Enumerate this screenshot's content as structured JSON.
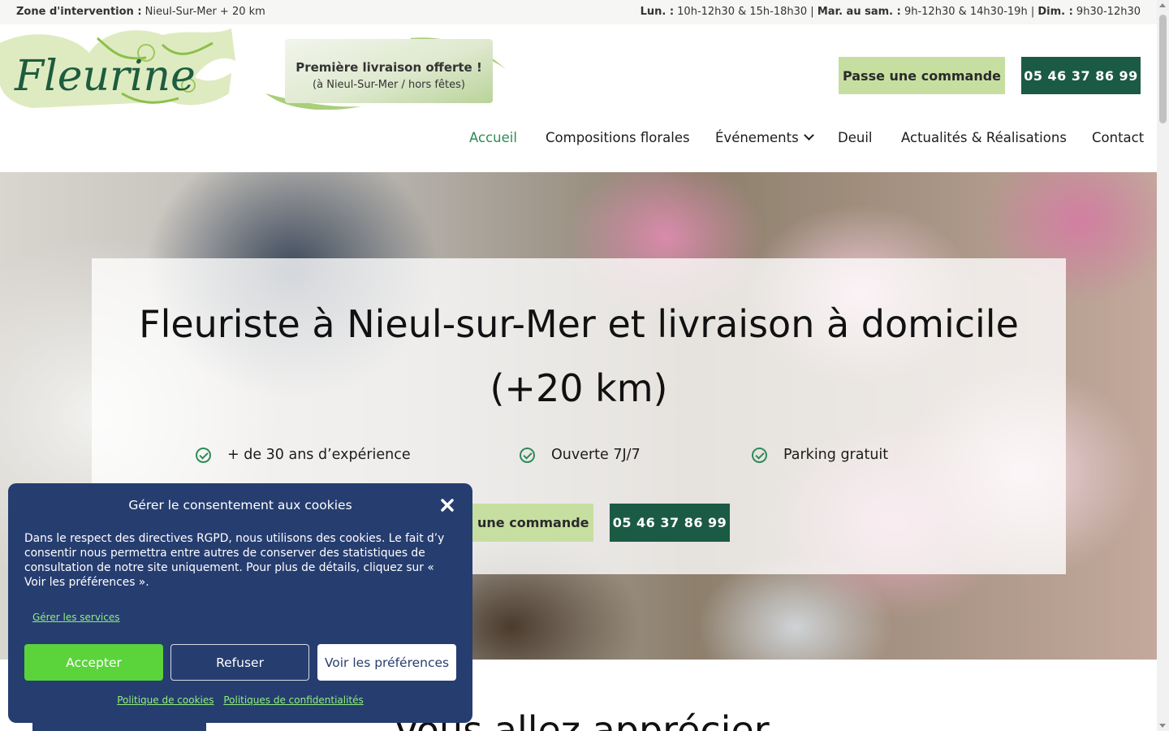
{
  "topbar": {
    "zone_label": "Zone d'intervention :",
    "zone_value": " Nieul-Sur-Mer + 20 km",
    "hours": [
      {
        "label": "Lun. :",
        "value": " 10h-12h30 & 15h-18h30 | "
      },
      {
        "label": "Mar. au sam. :",
        "value": " 9h-12h30 & 14h30-19h | "
      },
      {
        "label": "Dim. :",
        "value": " 9h30-12h30"
      }
    ]
  },
  "header": {
    "logo_text": "Fleurine",
    "banner_line1": "Première livraison offerte !",
    "banner_line2": "(à Nieul-Sur-Mer / hors fêtes)",
    "order_button": "Passe une commande",
    "phone_button": "05 46 37 86 99"
  },
  "nav": {
    "items": [
      {
        "label": "Accueil",
        "active": true
      },
      {
        "label": "Compositions florales"
      },
      {
        "label": "Événements",
        "has_dropdown": true
      },
      {
        "label": "Deuil"
      },
      {
        "label": "Actualités & Réalisations"
      },
      {
        "label": "Contact"
      }
    ]
  },
  "hero": {
    "title": "Fleuriste à Nieul-sur-Mer et livraison à domicile (+20 km)",
    "features": [
      "+ de 30 ans d’expérience",
      "Ouverte 7J/7",
      "Parking gratuit"
    ],
    "order_button": "Passe une commande",
    "phone_button": "05 46 37 86 99"
  },
  "section": {
    "title": "Vous allez apprécier"
  },
  "cookie": {
    "title": "Gérer le consentement aux cookies",
    "text": "Dans le respect des directives RGPD, nous utilisons des cookies. Le fait d’y consentir nous permettra entre autres de conserver des statistiques de consultation de notre site uniquement. Pour plus de détails, cliquez sur « Voir les préférences ».",
    "manage_services": "Gérer les services",
    "accept": "Accepter",
    "refuse": "Refuser",
    "preferences": "Voir les préférences",
    "cookie_policy": "Politique de cookies",
    "privacy_policy": "Politiques de confidentialités"
  },
  "colors": {
    "brand_green": "#1b5a45",
    "light_green": "#c7dea1",
    "active_nav": "#2e8b57",
    "cookie_bg": "#263d70",
    "accept_green": "#5ad43a"
  },
  "icons": [
    "check-circle-icon",
    "chevron-down-icon",
    "close-icon"
  ]
}
